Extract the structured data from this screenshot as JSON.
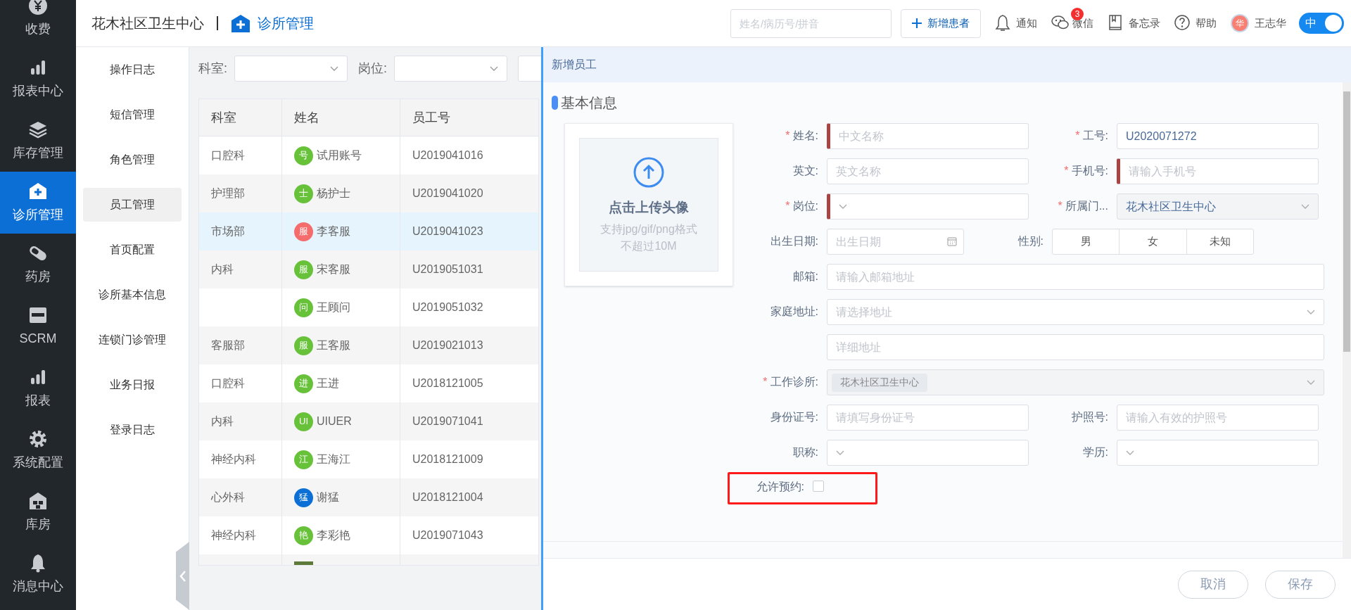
{
  "nav": {
    "items": [
      {
        "label": "收费",
        "selected": false
      },
      {
        "label": "报表中心",
        "selected": false
      },
      {
        "label": "库存管理",
        "selected": false
      },
      {
        "label": "诊所管理",
        "selected": true
      },
      {
        "label": "药房",
        "selected": false
      },
      {
        "label": "SCRM",
        "selected": false
      },
      {
        "label": "报表",
        "selected": false
      },
      {
        "label": "系统配置",
        "selected": false
      },
      {
        "label": "库房",
        "selected": false
      },
      {
        "label": "消息中心",
        "selected": false
      }
    ]
  },
  "header": {
    "title": "花木社区卫生中心",
    "module": "诊所管理"
  },
  "topbar": {
    "search_placeholder": "姓名/病历号/拼音",
    "new_button": "新增患者",
    "links": [
      {
        "label": "通知"
      },
      {
        "label": "微信",
        "badge": "3"
      },
      {
        "label": "备忘录"
      },
      {
        "label": "帮助"
      }
    ],
    "user": {
      "avatar": "华",
      "name": "王志华"
    },
    "toggle": {
      "label": "中",
      "on": true
    }
  },
  "submenu": {
    "items": [
      {
        "label": "操作日志",
        "selected": false
      },
      {
        "label": "短信管理",
        "selected": false
      },
      {
        "label": "角色管理",
        "selected": false
      },
      {
        "label": "员工管理",
        "selected": true
      },
      {
        "label": "首页配置",
        "selected": false
      },
      {
        "label": "诊所基本信息",
        "selected": false
      },
      {
        "label": "连锁门诊管理",
        "selected": false
      },
      {
        "label": "业务日报",
        "selected": false
      },
      {
        "label": "登录日志",
        "selected": false
      }
    ]
  },
  "filters": [
    {
      "label": "科室:"
    },
    {
      "label": "岗位:"
    }
  ],
  "table": {
    "columns": [
      "科室",
      "姓名",
      "员工号"
    ],
    "rows": [
      {
        "dept": "口腔科",
        "kind": "initial",
        "avatar": "号",
        "color": "#67c23a",
        "name": "试用账号",
        "id": "U2019041016",
        "selected": false
      },
      {
        "dept": "护理部",
        "kind": "initial",
        "avatar": "士",
        "color": "#67c23a",
        "name": "杨护士",
        "id": "U2019041020",
        "selected": false
      },
      {
        "dept": "市场部",
        "kind": "initial",
        "avatar": "服",
        "color": "#f56c6c",
        "name": "李客服",
        "id": "U2019041023",
        "selected": true
      },
      {
        "dept": "内科",
        "kind": "initial",
        "avatar": "服",
        "color": "#67c23a",
        "name": "宋客服",
        "id": "U2019051031",
        "selected": false
      },
      {
        "kind": "initial",
        "avatar": "问",
        "color": "#67c23a",
        "name": "王顾问",
        "id": "U2019051032",
        "selected": false
      },
      {
        "dept": "客服部",
        "kind": "initial",
        "avatar": "服",
        "color": "#67c23a",
        "name": "王客服",
        "id": "U2019021013",
        "selected": false
      },
      {
        "dept": "口腔科",
        "kind": "initial",
        "avatar": "进",
        "color": "#67c23a",
        "name": "王进",
        "id": "U2018121005",
        "selected": false
      },
      {
        "dept": "内科",
        "kind": "initial",
        "avatar": "UI",
        "color": "#67c23a",
        "name": "UIUER",
        "id": "U2019071041",
        "selected": false
      },
      {
        "dept": "神经内科",
        "kind": "initial",
        "avatar": "江",
        "color": "#67c23a",
        "name": "王海江",
        "id": "U2018121009",
        "selected": false
      },
      {
        "dept": "心外科",
        "kind": "initial",
        "avatar": "猛",
        "color": "#0b6fd6",
        "name": "谢猛",
        "id": "U2018121004",
        "selected": false
      },
      {
        "dept": "神经内科",
        "kind": "initial",
        "avatar": "艳",
        "color": "#67c23a",
        "name": "李彩艳",
        "id": "U2019071043",
        "selected": false
      },
      {
        "kind": "photo",
        "selected": false
      }
    ]
  },
  "drawer": {
    "title": "新增员工",
    "section": "基本信息",
    "upload": {
      "title": "点击上传头像",
      "hint": "支持jpg/gif/png格式",
      "limit": "不超过10M"
    },
    "rows": [
      [
        {
          "kind": "text",
          "label": "姓名:",
          "required_mark": "*",
          "placeholder": "中文名称",
          "invalid": true
        },
        {
          "kind": "text",
          "label": "工号:",
          "required_mark": "*",
          "value": "U2020071272",
          "invalid": false
        }
      ],
      [
        {
          "kind": "text",
          "label": "英文:",
          "placeholder": "英文名称",
          "invalid": false
        },
        {
          "kind": "text",
          "label": "手机号:",
          "required_mark": "*",
          "placeholder": "请输入手机号",
          "invalid": true
        }
      ],
      [
        {
          "kind": "select",
          "label": "岗位:",
          "required_mark": "*",
          "invalid": true,
          "disabled": false
        },
        {
          "kind": "select",
          "label": "所属门...",
          "required_mark": "*",
          "value": "花木社区卫生中心",
          "invalid": false,
          "disabled": true
        }
      ],
      [
        {
          "kind": "date",
          "label": "出生日期:",
          "placeholder": "出生日期"
        },
        {
          "kind": "segmented",
          "label": "性别:",
          "options": [
            {
              "label": "男",
              "selected": false
            },
            {
              "label": "女",
              "selected": false
            },
            {
              "label": "未知",
              "selected": false
            }
          ]
        }
      ],
      [
        {
          "kind": "text",
          "label": "邮箱:",
          "placeholder": "请输入邮箱地址",
          "invalid": false
        }
      ],
      [
        {
          "kind": "select",
          "label": "家庭地址:",
          "placeholder": "请选择地址",
          "invalid": false,
          "disabled": false
        }
      ],
      [
        {
          "kind": "text",
          "placeholder": "详细地址",
          "invalid": false
        }
      ],
      [
        {
          "kind": "tags",
          "label": "工作诊所:",
          "required_mark": "*",
          "tags": [
            "花木社区卫生中心"
          ],
          "disabled": true
        }
      ],
      [
        {
          "kind": "text",
          "label": "身份证号:",
          "placeholder": "请填写身份证号",
          "invalid": false
        },
        {
          "kind": "text",
          "label": "护照号:",
          "placeholder": "请输入有效的护照号",
          "invalid": false
        }
      ],
      [
        {
          "kind": "select",
          "label": "职称:",
          "invalid": false,
          "disabled": false
        },
        {
          "kind": "select",
          "label": "学历:",
          "invalid": false,
          "disabled": false
        }
      ],
      [
        {
          "kind": "checkbox",
          "label": "允许预约:",
          "checked": false,
          "highlighted": true
        }
      ]
    ],
    "buttons": [
      "取消",
      "保存"
    ]
  }
}
